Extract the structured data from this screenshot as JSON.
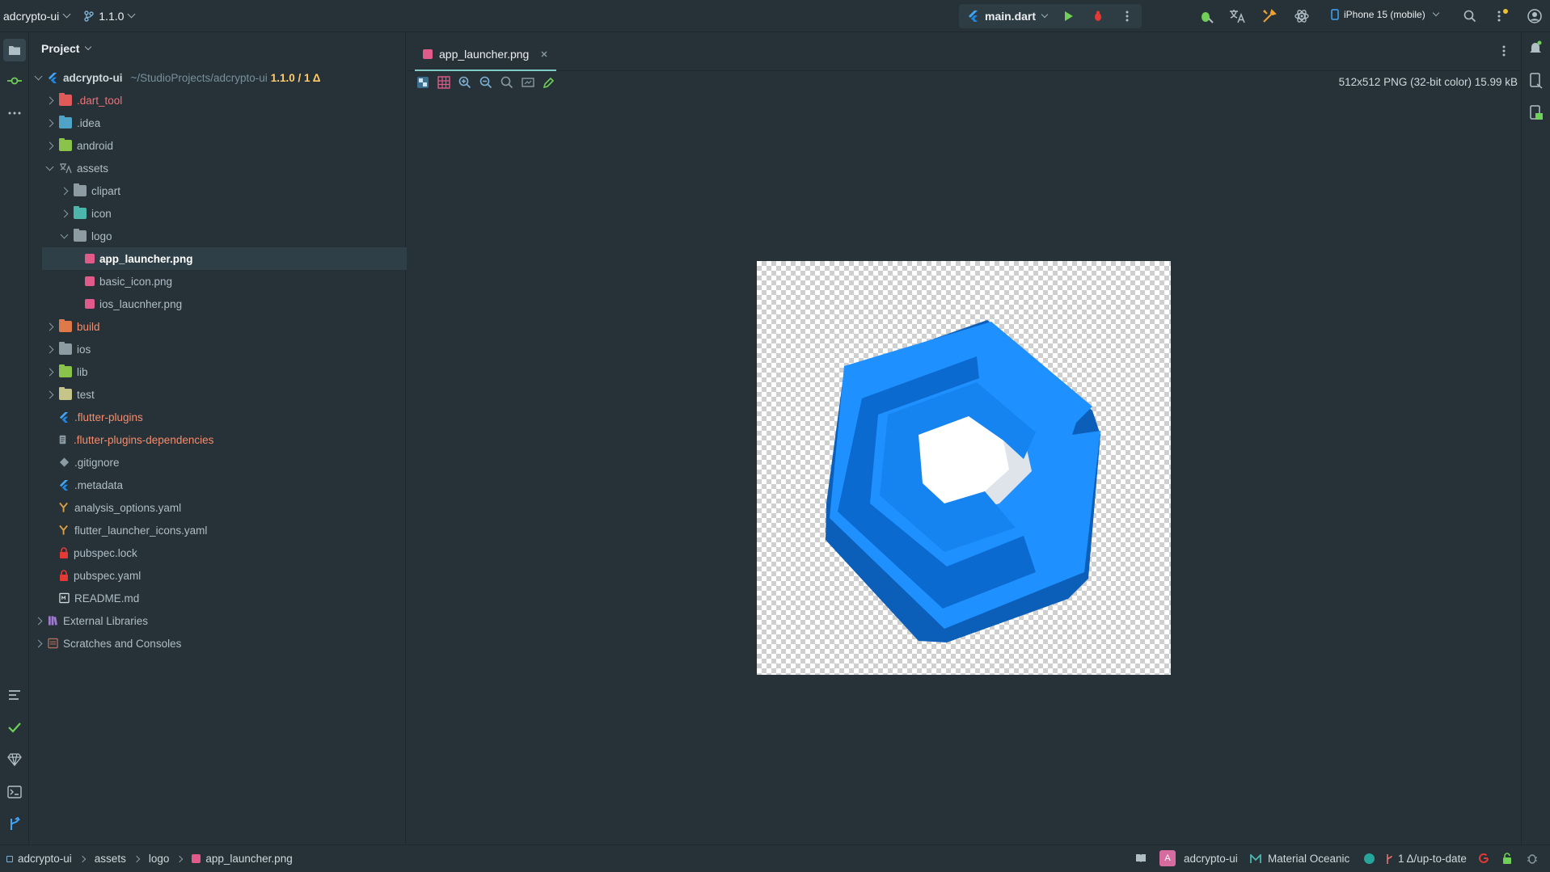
{
  "topbar": {
    "project_name": "adcrypto-ui",
    "branch": "1.1.0",
    "run_config": "main.dart",
    "device": "iPhone 15 (mobile)"
  },
  "project_panel": {
    "title": "Project",
    "root": {
      "name": "adcrypto-ui",
      "path": "~/StudioProjects/adcrypto-ui",
      "vcs": "1.1.0 / 1 Δ"
    },
    "items": [
      {
        "label": ".dart_tool",
        "color": "#f07178"
      },
      {
        "label": ".idea",
        "color": "#8c9ba3"
      },
      {
        "label": "android",
        "color": "#8c9ba3"
      },
      {
        "label": "assets",
        "color": "#8c9ba3"
      },
      {
        "label": "clipart",
        "color": "#8c9ba3"
      },
      {
        "label": "icon",
        "color": "#8c9ba3"
      },
      {
        "label": "logo",
        "color": "#8c9ba3"
      },
      {
        "label": "app_launcher.png",
        "color": "#ffffff"
      },
      {
        "label": "basic_icon.png",
        "color": "#8c9ba3"
      },
      {
        "label": "ios_laucnher.png",
        "color": "#8c9ba3"
      },
      {
        "label": "build",
        "color": "#f78c6c"
      },
      {
        "label": "ios",
        "color": "#8c9ba3"
      },
      {
        "label": "lib",
        "color": "#8c9ba3"
      },
      {
        "label": "test",
        "color": "#8c9ba3"
      },
      {
        "label": ".flutter-plugins",
        "color": "#f78c6c"
      },
      {
        "label": ".flutter-plugins-dependencies",
        "color": "#f78c6c"
      },
      {
        "label": ".gitignore",
        "color": "#8c9ba3"
      },
      {
        "label": ".metadata",
        "color": "#8c9ba3"
      },
      {
        "label": "analysis_options.yaml",
        "color": "#8c9ba3"
      },
      {
        "label": "flutter_launcher_icons.yaml",
        "color": "#8c9ba3"
      },
      {
        "label": "pubspec.lock",
        "color": "#8c9ba3"
      },
      {
        "label": "pubspec.yaml",
        "color": "#8c9ba3"
      },
      {
        "label": "README.md",
        "color": "#8c9ba3"
      },
      {
        "label": "External Libraries",
        "color": "#8c9ba3"
      },
      {
        "label": "Scratches and Consoles",
        "color": "#8c9ba3"
      }
    ]
  },
  "editor": {
    "tab_label": "app_launcher.png",
    "image_info": "512x512 PNG (32-bit color) 15.99 kB"
  },
  "statusbar": {
    "breadcrumb": [
      "adcrypto-ui",
      "assets",
      "logo",
      "app_launcher.png"
    ],
    "project_badge": "A",
    "project": "adcrypto-ui",
    "theme": "Material Oceanic",
    "vcs_status": "1 Δ/up-to-date"
  },
  "colors": {
    "background": "#263238",
    "accent": "#80cbc4",
    "logo_blue": "#1e90ff"
  }
}
